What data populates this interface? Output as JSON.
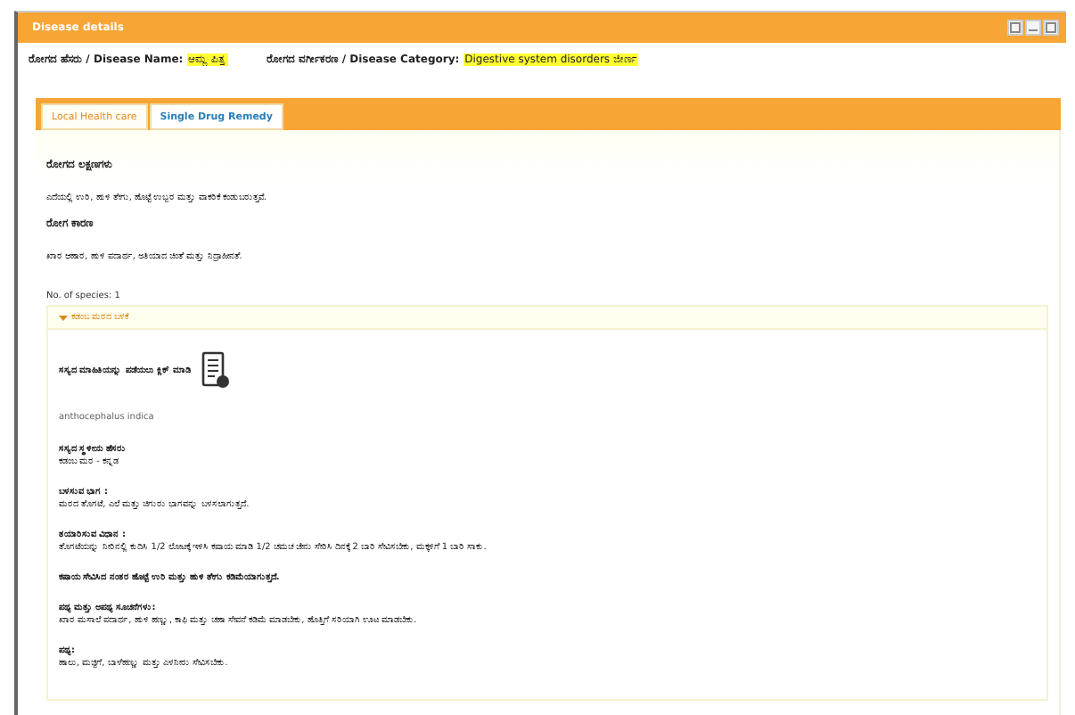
{
  "window": {
    "title": "Disease details"
  },
  "header": {
    "name_label": "ರೋಗದ ಹೆಸರು / Disease Name:",
    "name_value": "ಆಮ್ಲ ಪಿತ್ತ",
    "category_label": "ರೋಗದ ವರ್ಗೀಕರಣ / Disease Category:",
    "category_value": "Digestive system disorders ಜೀರ್ಣ"
  },
  "tabs": [
    {
      "label": "Local Health care",
      "selected": true
    },
    {
      "label": "Single Drug Remedy",
      "selected": false
    }
  ],
  "sections": [
    {
      "heading": "ರೋಗದ ಲಕ್ಷಣಗಳು",
      "text": "ಎದೆಯಲ್ಲಿ ಉರಿ, ಹುಳಿ ತೇಗು, ಹೊಟ್ಟೆ ಉಬ್ಬರ ಮತ್ತು ವಾಕರಿಕೆ ಕಂಡುಬರುತ್ತವೆ."
    },
    {
      "heading": "ರೋಗ ಕಾರಣ",
      "text": "ಖಾರ ಆಹಾರ, ಹುಳಿ ಪದಾರ್ಥ, ಅತಿಯಾದ ಚಿಂತೆ ಮತ್ತು ನಿದ್ರಾಹೀನತೆ."
    }
  ],
  "species_count": "No. of species: 1",
  "accordion": {
    "title": "ಕಡಂಬ ಮರದ ಬಳಕೆ",
    "expanded": true,
    "link_text": "ಸಸ್ಯದ ಮಾಹಿತಿಯನ್ನು ಪಡೆಯಲು ಕ್ಲಿಕ್ ಮಾಡಿ",
    "botanical_name": "anthocephalus indica",
    "details": [
      {
        "label": "ಸಸ್ಯದ ಸ್ಥಳೀಯ ಹೆಸರು",
        "text": "ಕಡಂಬ ಮರ - ಕನ್ನಡ"
      },
      {
        "label": "ಬಳಸುವ ಭಾಗ :",
        "text": "ಮರದ ತೊಗಟೆ, ಎಲೆ ಮತ್ತು ಚಿಗುರು ಭಾಗವನ್ನು ಬಳಸಲಾಗುತ್ತದೆ."
      },
      {
        "label": "ತಯಾರಿಸುವ ವಿಧಾನ :",
        "text": "ತೊಗಟೆಯನ್ನು ನೀರಿನಲ್ಲಿ ಕುದಿಸಿ 1/2 ಲೋಟಕ್ಕೆ ಇಳಿಸಿ ಕಷಾಯ ಮಾಡಿ 1/2 ಚಮಚ ಜೇನು ಸೇರಿಸಿ ದಿನಕ್ಕೆ 2 ಬಾರಿ ಸೇವಿಸಬೇಕು, ಮಕ್ಕಳಿಗೆ 1 ಬಾರಿ ಸಾಕು."
      },
      {
        "label": "ಕಷಾಯ ಸೇವಿಸಿದ ನಂತರ ಹೊಟ್ಟೆ ಉರಿ ಮತ್ತು ಹುಳಿ ತೇಗು ಕಡಿಮೆಯಾಗುತ್ತದೆ."
      },
      {
        "label": "ಪಥ್ಯ ಮತ್ತು ಅಪಥ್ಯ ಸೂಚನೆಗಳು:",
        "text": "ಖಾರ ಮಸಾಲೆ ಪದಾರ್ಥ, ಹುಳಿ ಹಣ್ಣು, ಕಾಫಿ ಮತ್ತು ಚಹಾ ಸೇವನೆ ಕಡಿಮೆ ಮಾಡಬೇಕು, ಹೊತ್ತಿಗೆ ಸರಿಯಾಗಿ ಊಟ ಮಾಡಬೇಕು."
      },
      {
        "label": "ಪಥ್ಯ:",
        "text": "ಹಾಲು, ಮಜ್ಜಿಗೆ, ಬಾಳೆಹಣ್ಣು ಮತ್ತು ಎಳನೀರು ಸೇವಿಸಬೇಕು."
      }
    ]
  }
}
